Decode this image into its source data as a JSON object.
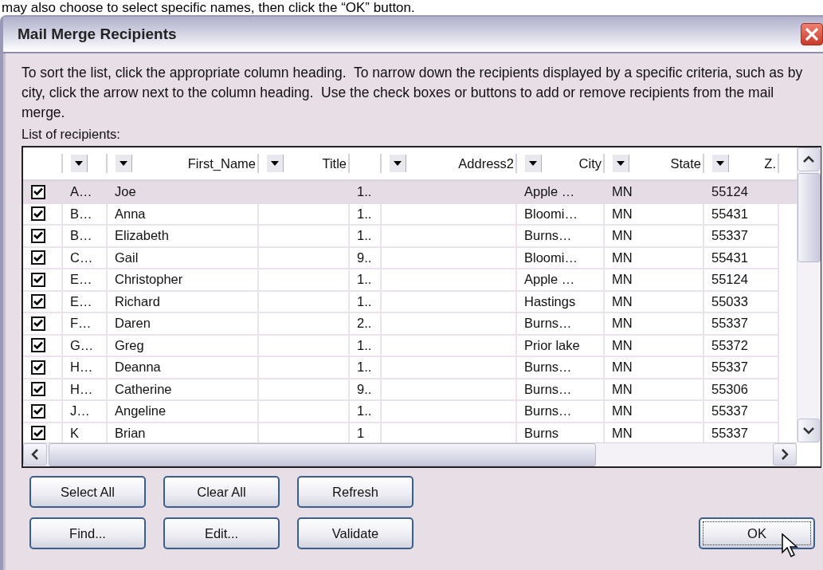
{
  "caption": "may also choose to select specific names, then click the “OK” button.",
  "window": {
    "title": "Mail Merge Recipients"
  },
  "instructions": "To sort the list, click the appropriate column heading.  To narrow down the recipients displayed by a specific criteria, such as by city, click the arrow next to the column heading.  Use the check boxes or buttons to add or remove recipients from the mail merge.",
  "list_label": {
    "text": "List of recipients:"
  },
  "table": {
    "columns": [
      {
        "filter": true
      },
      {
        "label": "First_Name",
        "filter": true
      },
      {
        "label": "Title",
        "filter": true
      },
      {},
      {
        "label": "Address2",
        "filter": true
      },
      {
        "label": "City",
        "filter": true
      },
      {
        "label": "State",
        "filter": true
      },
      {
        "label": "Z.",
        "filter": true
      }
    ],
    "rows": [
      {
        "checked": true,
        "selected": true,
        "cells": [
          "A…",
          "Joe",
          null,
          "1..",
          null,
          "Apple …",
          "MN",
          "55124"
        ]
      },
      {
        "checked": true,
        "selected": false,
        "cells": [
          "B…",
          "Anna",
          null,
          "1..",
          null,
          "Bloomi…",
          "MN",
          "55431"
        ]
      },
      {
        "checked": true,
        "selected": false,
        "cells": [
          "B…",
          "Elizabeth",
          null,
          "1..",
          null,
          "Burns…",
          "MN",
          "55337"
        ]
      },
      {
        "checked": true,
        "selected": false,
        "cells": [
          "C…",
          "Gail",
          null,
          "9..",
          null,
          "Bloomi…",
          "MN",
          "55431"
        ]
      },
      {
        "checked": true,
        "selected": false,
        "cells": [
          "E…",
          "Christopher",
          null,
          "1..",
          null,
          "Apple …",
          "MN",
          "55124"
        ]
      },
      {
        "checked": true,
        "selected": false,
        "cells": [
          "E…",
          "Richard",
          null,
          "1..",
          null,
          "Hastings",
          "MN",
          "55033"
        ]
      },
      {
        "checked": true,
        "selected": false,
        "cells": [
          "F…",
          "Daren",
          null,
          "2..",
          null,
          "Burns…",
          "MN",
          "55337"
        ]
      },
      {
        "checked": true,
        "selected": false,
        "cells": [
          "G…",
          "Greg",
          null,
          "1..",
          null,
          "Prior lake",
          "MN",
          "55372"
        ]
      },
      {
        "checked": true,
        "selected": false,
        "cells": [
          "H…",
          "Deanna",
          null,
          "1..",
          null,
          "Burns…",
          "MN",
          "55337"
        ]
      },
      {
        "checked": true,
        "selected": false,
        "cells": [
          "H…",
          "Catherine",
          null,
          "9..",
          null,
          "Burns…",
          "MN",
          "55306"
        ]
      },
      {
        "checked": true,
        "selected": false,
        "cells": [
          "J…",
          "Angeline",
          null,
          "1..",
          null,
          "Burns…",
          "MN",
          "55337"
        ]
      },
      {
        "checked": true,
        "selected": false,
        "cells": [
          "K",
          "Brian",
          null,
          "1",
          null,
          "Burns",
          "MN",
          "55337"
        ]
      }
    ]
  },
  "buttons": [
    {
      "label": "Select All"
    },
    {
      "label": "Clear All"
    },
    {
      "label": "Refresh"
    },
    {
      "label": "Find..."
    },
    {
      "label": "Edit..."
    },
    {
      "label": "Validate"
    }
  ],
  "ok_button": {
    "label": "OK",
    "focused": true
  }
}
